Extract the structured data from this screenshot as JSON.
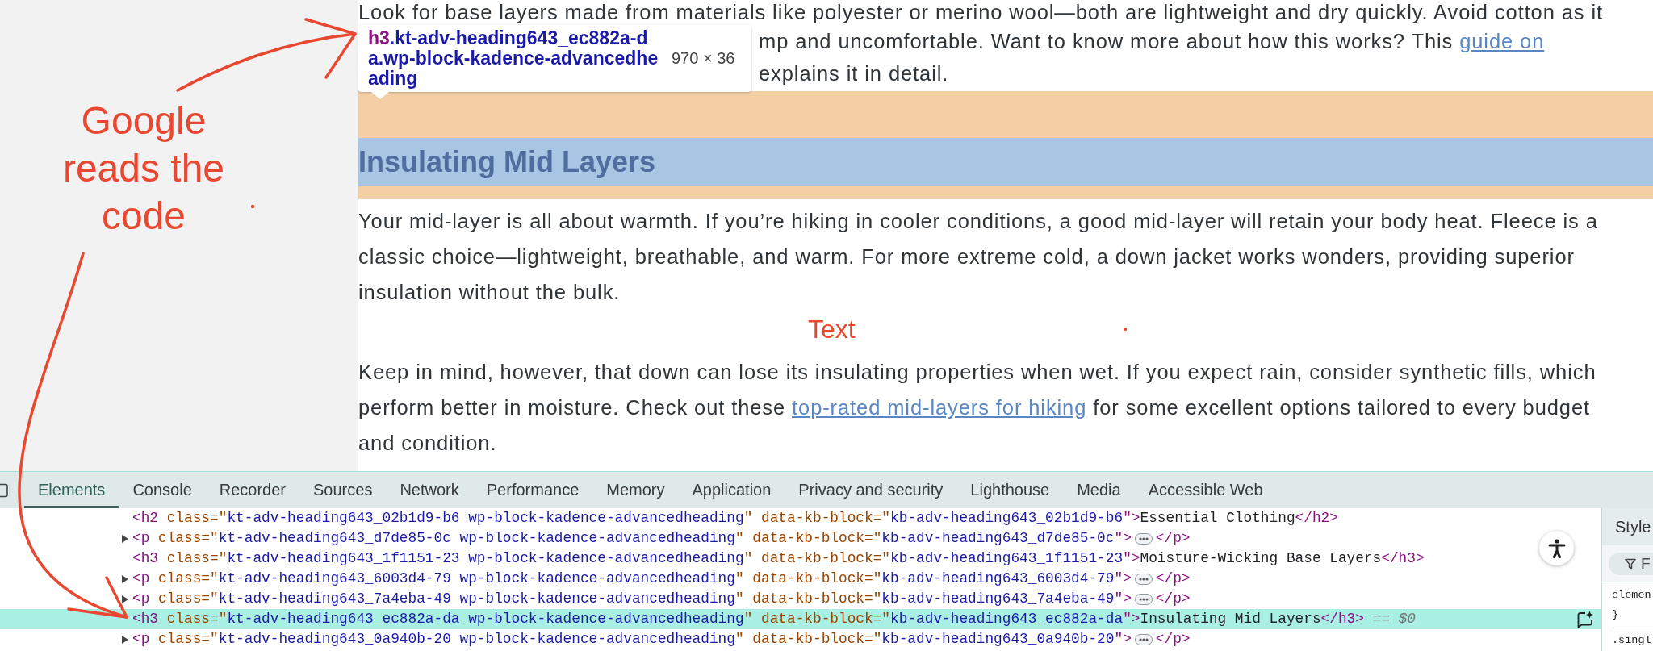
{
  "article": {
    "intro_lines": [
      {
        "segments": [
          {
            "kind": "text",
            "text": "Look for base layers made from materials like polyester or merino wool—both are lightweight and dry quickly. Avoid cotton as it"
          }
        ]
      },
      {
        "segments": [
          {
            "kind": "text",
            "text": "mp and uncomfortable. Want to know more about how this works? This "
          },
          {
            "kind": "link",
            "text": "guide on"
          }
        ]
      },
      {
        "segments": [
          {
            "kind": "text",
            "text": "explains it in detail."
          }
        ]
      }
    ],
    "inspect_tooltip": {
      "tag": "h3",
      "selector": ".kt-adv-heading643_ec882a-da.wp-block-kadence-advancedheading",
      "size": "970 × 36"
    },
    "highlighted_heading": "Insulating Mid Layers",
    "paragraphs": [
      {
        "segments": [
          {
            "kind": "text",
            "text": "Your mid-layer is all about warmth. If you’re hiking in cooler conditions, a good mid-layer will retain your body heat. Fleece is a classic choice—lightweight, breathable, and warm. For more extreme cold, a down jacket works wonders, providing superior insulation without the bulk."
          }
        ]
      },
      {
        "segments": [
          {
            "kind": "text",
            "text": "Keep in mind, however, that down can lose its insulating properties when wet. If you expect rain, consider synthetic fills, which perform better in moisture. Check out these "
          },
          {
            "kind": "link",
            "text": "top-rated mid-layers for hiking"
          },
          {
            "kind": "text",
            "text": " for some excellent options tailored to every budget and condition."
          }
        ]
      }
    ]
  },
  "annotations": [
    {
      "kind": "callout",
      "text": "Google reads the code"
    },
    {
      "kind": "label",
      "text": "Text"
    }
  ],
  "devtools": {
    "tabs": [
      {
        "label": "Elements",
        "selected": true
      },
      {
        "label": "Console",
        "selected": false
      },
      {
        "label": "Recorder",
        "selected": false
      },
      {
        "label": "Sources",
        "selected": false
      },
      {
        "label": "Network",
        "selected": false
      },
      {
        "label": "Performance",
        "selected": false
      },
      {
        "label": "Memory",
        "selected": false
      },
      {
        "label": "Application",
        "selected": false
      },
      {
        "label": "Privacy and security",
        "selected": false
      },
      {
        "label": "Lighthouse",
        "selected": false
      },
      {
        "label": "Media",
        "selected": false
      },
      {
        "label": "Accessible Web",
        "selected": false
      }
    ],
    "dom_rows": [
      {
        "kind": "leaf",
        "selected": false,
        "segments": [
          {
            "kind": "tag",
            "text": "<h2"
          },
          {
            "kind": "attr",
            "text": " class=\""
          },
          {
            "kind": "value",
            "text": "kt-adv-heading643_02b1d9-b6 wp-block-kadence-advancedheading"
          },
          {
            "kind": "attr",
            "text": "\" data-kb-block=\""
          },
          {
            "kind": "value",
            "text": "kb-adv-heading643_02b1d9-b6"
          },
          {
            "kind": "tag",
            "text": "\">"
          },
          {
            "kind": "text",
            "text": "Essential Clothing"
          },
          {
            "kind": "tag",
            "text": "</h2>"
          }
        ]
      },
      {
        "kind": "container",
        "selected": false,
        "expanded": false,
        "segments": [
          {
            "kind": "tag",
            "text": "<p"
          },
          {
            "kind": "attr",
            "text": " class=\""
          },
          {
            "kind": "value",
            "text": "kt-adv-heading643_d7de85-0c wp-block-kadence-advancedheading"
          },
          {
            "kind": "attr",
            "text": "\" data-kb-block=\""
          },
          {
            "kind": "value",
            "text": "kb-adv-heading643_d7de85-0c"
          },
          {
            "kind": "tag",
            "text": "\">"
          }
        ],
        "closing": [
          {
            "kind": "tag",
            "text": "</p>"
          }
        ]
      },
      {
        "kind": "leaf",
        "selected": false,
        "segments": [
          {
            "kind": "tag",
            "text": "<h3"
          },
          {
            "kind": "attr",
            "text": " class=\""
          },
          {
            "kind": "value",
            "text": "kt-adv-heading643_1f1151-23 wp-block-kadence-advancedheading"
          },
          {
            "kind": "attr",
            "text": "\" data-kb-block=\""
          },
          {
            "kind": "value",
            "text": "kb-adv-heading643_1f1151-23"
          },
          {
            "kind": "tag",
            "text": "\">"
          },
          {
            "kind": "text",
            "text": "Moisture-Wicking Base Layers"
          },
          {
            "kind": "tag",
            "text": "</h3>"
          }
        ]
      },
      {
        "kind": "container",
        "selected": false,
        "expanded": false,
        "segments": [
          {
            "kind": "tag",
            "text": "<p"
          },
          {
            "kind": "attr",
            "text": " class=\""
          },
          {
            "kind": "value",
            "text": "kt-adv-heading643_6003d4-79 wp-block-kadence-advancedheading"
          },
          {
            "kind": "attr",
            "text": "\" data-kb-block=\""
          },
          {
            "kind": "value",
            "text": "kb-adv-heading643_6003d4-79"
          },
          {
            "kind": "tag",
            "text": "\">"
          }
        ],
        "closing": [
          {
            "kind": "tag",
            "text": "</p>"
          }
        ]
      },
      {
        "kind": "container",
        "selected": false,
        "expanded": false,
        "segments": [
          {
            "kind": "tag",
            "text": "<p"
          },
          {
            "kind": "attr",
            "text": " class=\""
          },
          {
            "kind": "value",
            "text": "kt-adv-heading643_7a4eba-49 wp-block-kadence-advancedheading"
          },
          {
            "kind": "attr",
            "text": "\" data-kb-block=\""
          },
          {
            "kind": "value",
            "text": "kb-adv-heading643_7a4eba-49"
          },
          {
            "kind": "tag",
            "text": "\">"
          }
        ],
        "closing": [
          {
            "kind": "tag",
            "text": "</p>"
          }
        ]
      },
      {
        "kind": "leaf",
        "selected": true,
        "segments": [
          {
            "kind": "tag",
            "text": "<h3"
          },
          {
            "kind": "attr",
            "text": " class=\""
          },
          {
            "kind": "value",
            "text": "kt-adv-heading643_ec882a-da wp-block-kadence-advancedheading"
          },
          {
            "kind": "attr",
            "text": "\" data-kb-block=\""
          },
          {
            "kind": "value",
            "text": "kb-adv-heading643_ec882a-da"
          },
          {
            "kind": "tag",
            "text": "\">"
          },
          {
            "kind": "text",
            "text": "Insulating Mid Layers"
          },
          {
            "kind": "tag",
            "text": "</h3>"
          },
          {
            "kind": "ref",
            "text": " == *$0*"
          }
        ]
      },
      {
        "kind": "container",
        "selected": false,
        "expanded": false,
        "segments": [
          {
            "kind": "tag",
            "text": "<p"
          },
          {
            "kind": "attr",
            "text": " class=\""
          },
          {
            "kind": "value",
            "text": "kt-adv-heading643_0a940b-20 wp-block-kadence-advancedheading"
          },
          {
            "kind": "attr",
            "text": "\" data-kb-block=\""
          },
          {
            "kind": "value",
            "text": "kb-adv-heading643_0a940b-20"
          },
          {
            "kind": "tag",
            "text": "\">"
          }
        ],
        "closing": [
          {
            "kind": "tag",
            "text": "</p>"
          }
        ]
      }
    ],
    "styles_pane": {
      "tab": "Style",
      "filter_placeholder": "F",
      "rule_blocks": [
        {
          "lines": [
            "elemen",
            "}"
          ]
        },
        {
          "lines": [
            ".singl"
          ]
        }
      ]
    }
  }
}
